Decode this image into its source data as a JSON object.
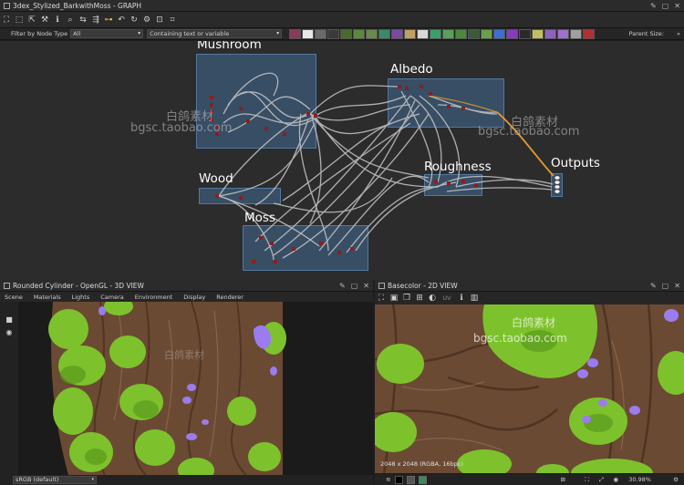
{
  "graph_panel": {
    "title": "3dex_Stylized_BarkwithMoss - GRAPH"
  },
  "filter": {
    "label": "Filter by Node Type",
    "value": "All",
    "text_placeholder": "Containing text or variable",
    "parent_size_label": "Parent Size:",
    "parent_size_btn": "»"
  },
  "frames": {
    "mushroom": "Mushroom",
    "albedo": "Albedo",
    "wood": "Wood",
    "moss": "Moss",
    "roughness": "Roughness",
    "outputs": "Outputs"
  },
  "watermarks": {
    "a": "白鸽素材",
    "b": "bgsc.taobao.com",
    "c": "白鸽素材",
    "d": "bgsc.taobao.com"
  },
  "view3d": {
    "title": "Rounded Cylinder - OpenGL - 3D VIEW",
    "menu": [
      "Scene",
      "Materials",
      "Lights",
      "Camera",
      "Environment",
      "Display",
      "Renderer"
    ],
    "colorspace": "sRGB (default)"
  },
  "view2d": {
    "title": "Basecolor - 2D VIEW",
    "uv_label": "UV",
    "resolution": "2048 x 2048 (RGBA, 16bpc)",
    "zoom": "30.98%",
    "watermark_a": "白鸽素材",
    "watermark_b": "bgsc.taobao.com"
  },
  "icons": {
    "pin": "pin-icon",
    "expand": "expand-icon",
    "close": "close-icon"
  },
  "colors": {
    "frame_blue": "#4678aa",
    "link_gray": "#c8c8c8",
    "output_link": "#e39a2e",
    "moss_green": "#7dc22c",
    "bark_brown": "#6b4a33",
    "mushroom_purple": "#9a7cf0"
  }
}
